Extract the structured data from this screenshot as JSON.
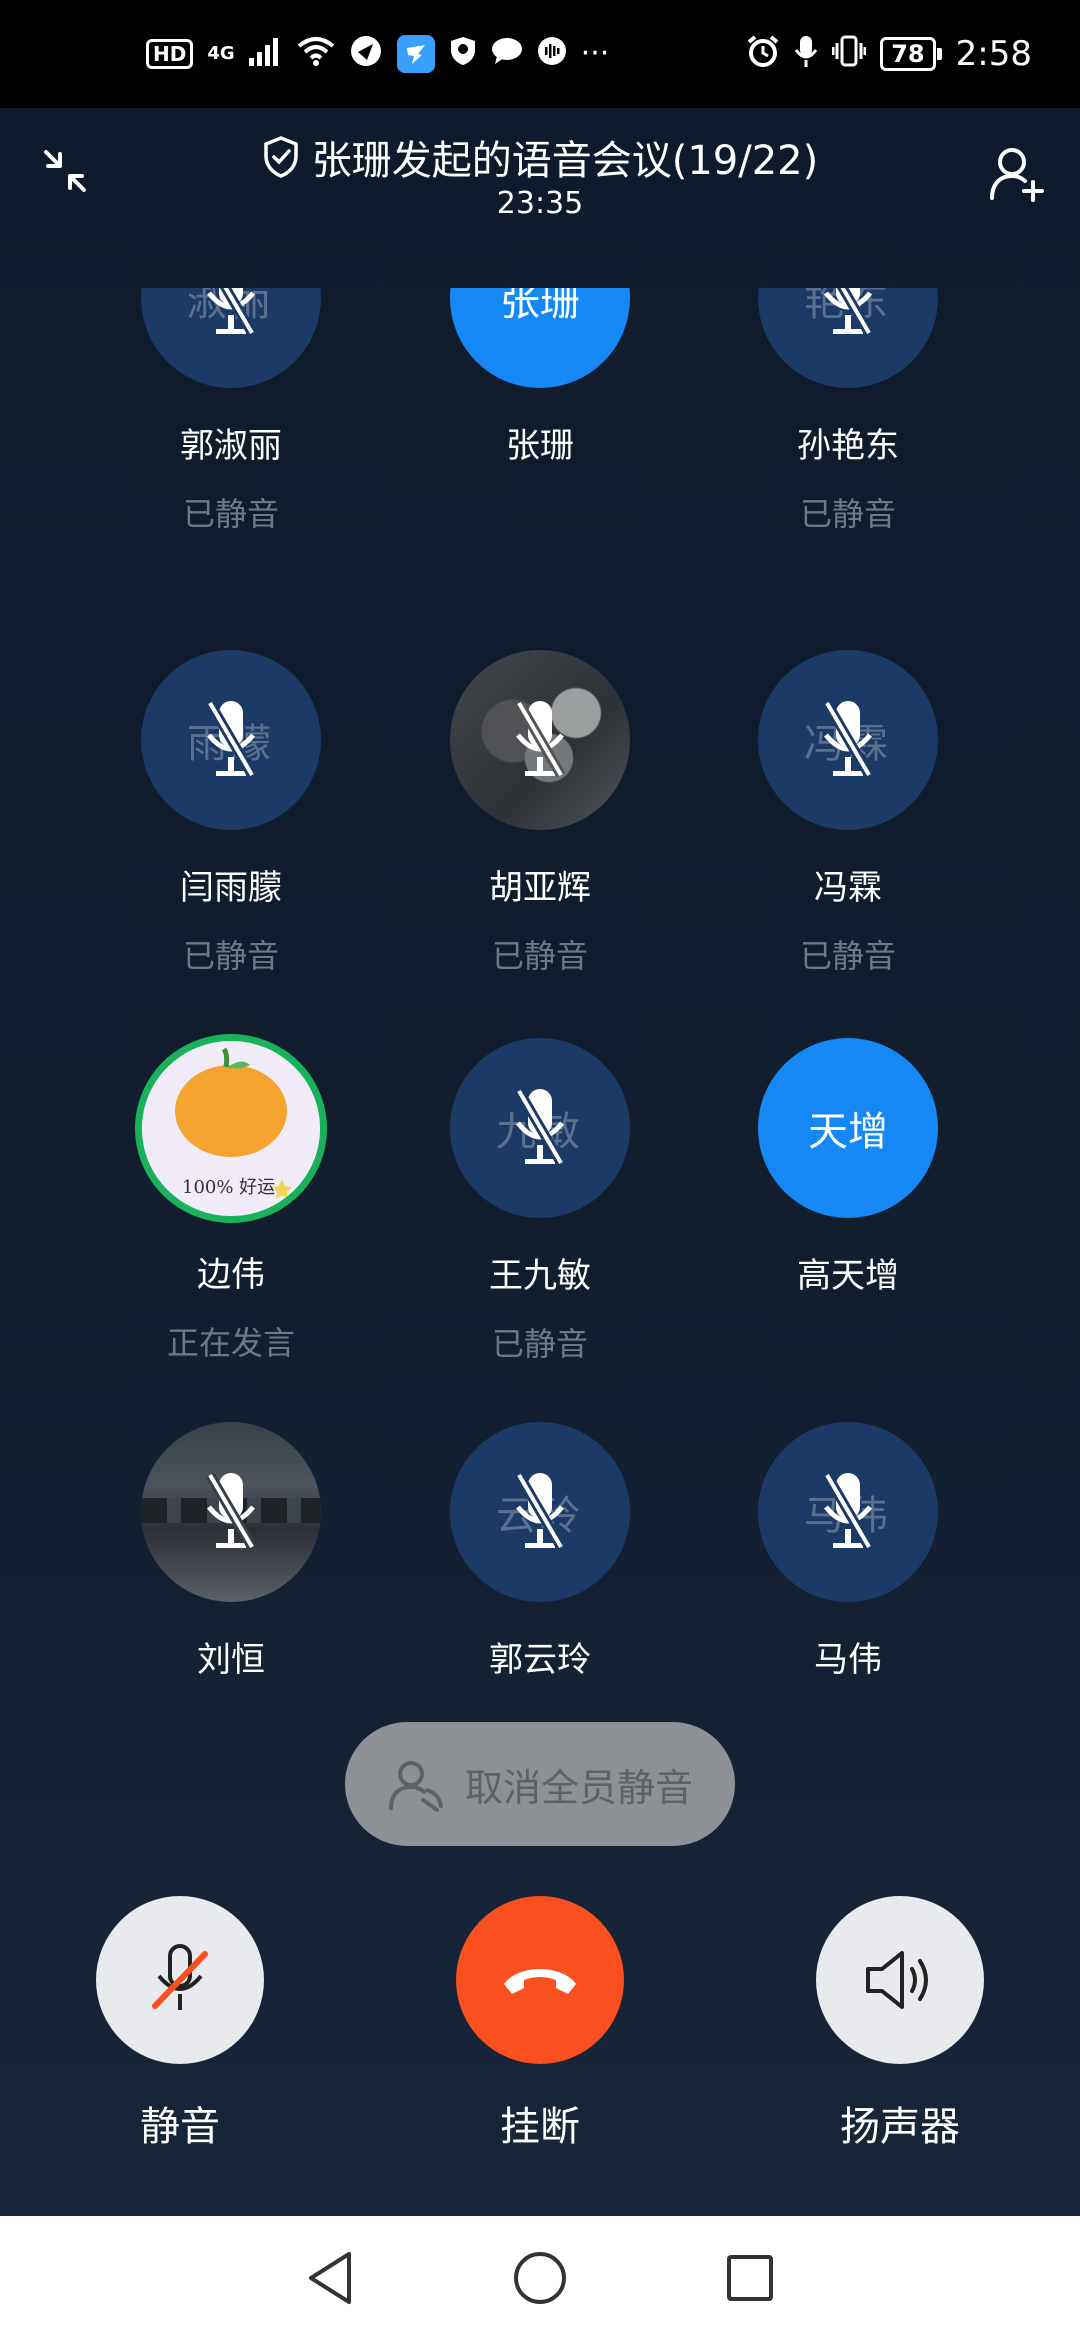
{
  "status_bar": {
    "hd": "HD",
    "network": "4G",
    "battery": "78",
    "time": "2:58",
    "more": "···"
  },
  "header": {
    "title": "张珊发起的语音会议(19/22)",
    "timer": "23:35"
  },
  "participants": [
    {
      "name": "郭淑丽",
      "status": "已静音",
      "initials": "淑丽",
      "muted": true,
      "avatar": "initials"
    },
    {
      "name": "张珊",
      "status": "",
      "initials": "张珊",
      "muted": false,
      "avatar": "blue"
    },
    {
      "name": "孙艳东",
      "status": "已静音",
      "initials": "艳东",
      "muted": true,
      "avatar": "initials"
    },
    {
      "name": "闫雨朦",
      "status": "已静音",
      "initials": "雨朦",
      "muted": true,
      "avatar": "initials"
    },
    {
      "name": "胡亚辉",
      "status": "已静音",
      "initials": "",
      "muted": true,
      "avatar": "photo-rabbit"
    },
    {
      "name": "冯霖",
      "status": "已静音",
      "initials": "冯霖",
      "muted": true,
      "avatar": "initials"
    },
    {
      "name": "边伟",
      "status": "正在发言",
      "initials": "",
      "muted": false,
      "avatar": "speaking"
    },
    {
      "name": "王九敏",
      "status": "已静音",
      "initials": "九敏",
      "muted": true,
      "avatar": "initials"
    },
    {
      "name": "高天增",
      "status": "",
      "initials": "天增",
      "muted": false,
      "avatar": "blue"
    },
    {
      "name": "刘恒",
      "status": "",
      "initials": "",
      "muted": true,
      "avatar": "photo-road"
    },
    {
      "name": "郭云玲",
      "status": "",
      "initials": "云玲",
      "muted": true,
      "avatar": "initials"
    },
    {
      "name": "马伟",
      "status": "",
      "initials": "马伟",
      "muted": true,
      "avatar": "initials"
    }
  ],
  "avatar_text": {
    "bianwei_caption": "100% 好运"
  },
  "unmute_all": {
    "label": "取消全员静音"
  },
  "controls": {
    "mute_label": "静音",
    "hangup_label": "挂断",
    "speaker_label": "扬声器"
  },
  "colors": {
    "accent_blue": "#1588f6",
    "hangup_red": "#fa4f1e",
    "speaking_green": "#19b25a",
    "muted_avatar": "#1c3a66",
    "background": "#101a28"
  }
}
